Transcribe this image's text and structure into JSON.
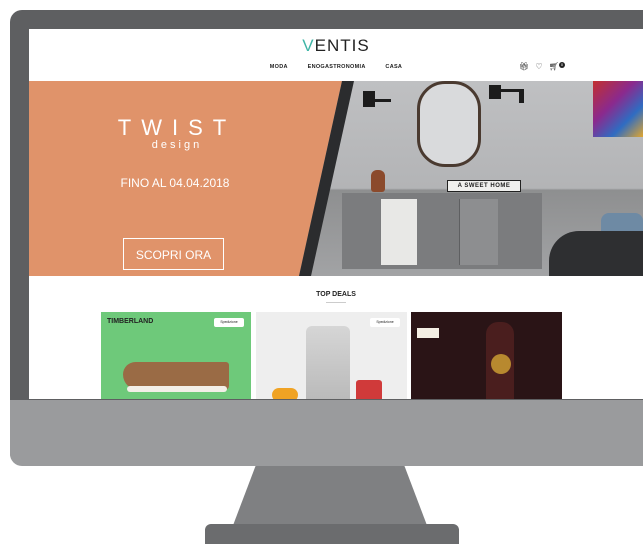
{
  "header": {
    "logo_v": "V",
    "logo_rest": "ENTIS",
    "nav": [
      "MODA",
      "ENOGASTRONOMIA",
      "CASA"
    ],
    "icons": [
      "gift-icon",
      "heart-icon",
      "cart-icon"
    ],
    "cart_count": "0"
  },
  "hero": {
    "title": "TWIST",
    "subtitle": "design",
    "date_text": "FINO AL 04.04.2018",
    "cta_label": "SCOPRI ORA",
    "sign_text": "A SWEET HOME",
    "accent_color": "#e0936a"
  },
  "deals": {
    "title": "TOP DEALS",
    "cards": [
      {
        "brand": "TIMBERLAND",
        "badge": "Spedizione"
      },
      {
        "brand": "",
        "badge": "Spedizione"
      },
      {
        "brand": "",
        "badge": ""
      }
    ]
  },
  "colors": {
    "logo_accent": "#3fb5a6",
    "monitor_frame": "#5e5f61",
    "monitor_chin": "#9a9b9d"
  }
}
